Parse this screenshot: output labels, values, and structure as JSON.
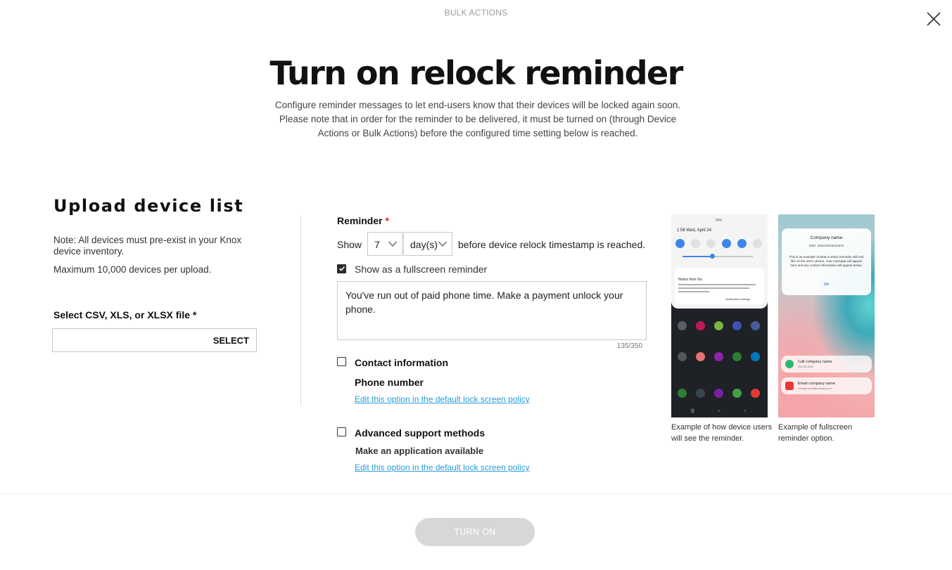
{
  "header": {
    "crumb": "BULK ACTIONS",
    "close_icon": "close-icon",
    "title": "Turn on relock reminder",
    "description": "Configure reminder messages to let end-users know that their devices will be locked again soon. Please note that in order for the reminder to be delivered, it must be turned on (through Device Actions or Bulk Actions) before the configured time setting below is reached."
  },
  "upload": {
    "title": "Upload device list",
    "note": "Note: All devices must pre-exist in your Knox device inventory.",
    "limit": "Maximum 10,000 devices per upload.",
    "file_label": "Select CSV, XLS, or XLSX file *",
    "file_value": "",
    "select_label": "SELECT"
  },
  "reminder": {
    "label": "Reminder",
    "required_mark": "*",
    "show_label": "Show",
    "amount": "7",
    "unit": "day(s)",
    "after_label": "before device relock timestamp is reached.",
    "fullscreen_checked": true,
    "fullscreen_label": "Show as a fullscreen reminder",
    "message": "You've run out of paid phone time. Make a payment unlock your phone.",
    "counter": "135/350",
    "contact_checked": false,
    "contact_label": "Contact information",
    "phone_label": "Phone number",
    "edit_link_1": "Edit this option in the default lock screen policy",
    "advanced_checked": false,
    "advanced_label": "Advanced support methods",
    "app_label": "Make an application available",
    "edit_link_2": "Edit this option in the default lock screen policy"
  },
  "previews": {
    "device": {
      "status": "74%",
      "time": "1:56  Wed, April 24",
      "notice": "Notice from %s",
      "notification_settings": "Notification settings",
      "caption": "Example of how device users will see the reminder."
    },
    "fullscreen": {
      "company": "Company name",
      "imei": "IMEI: 359225038932976",
      "body": "This is an example of what a relock reminder will look like on the user's phone. Your message will appear here and any contact information will appear below.",
      "ok": "OK",
      "call_title": "Call company name",
      "call_sub": "555-555-5555",
      "email_title": "Email company name",
      "email_sub": "example.email@company.com",
      "caption": "Example of fullscreen reminder option."
    }
  },
  "footer": {
    "turn_on_label": "TURN ON"
  },
  "colors": {
    "link": "#2a9bd6",
    "required": "#e0222c",
    "disabled_button": "#d7d7d7"
  }
}
